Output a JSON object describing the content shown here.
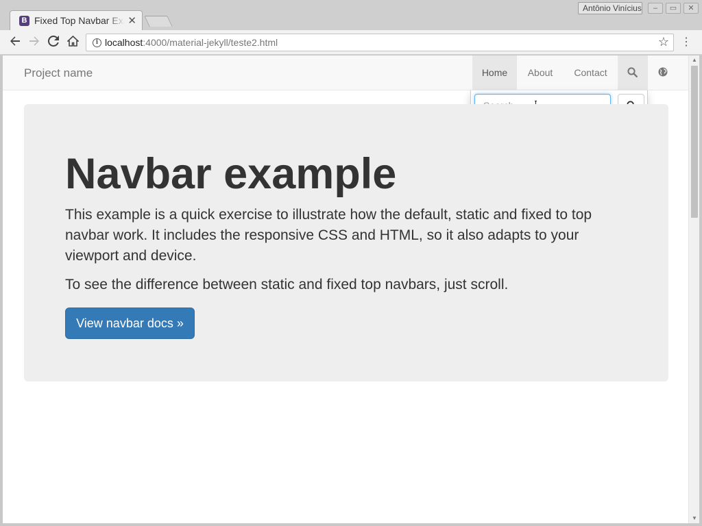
{
  "browser": {
    "tab": {
      "favicon_letter": "B",
      "title": "Fixed Top Navbar Example"
    },
    "user_name": "Antônio Vinícius",
    "omnibox": {
      "host": "localhost",
      "path": ":4000/material-jekyll/teste2.html"
    }
  },
  "navbar": {
    "brand": "Project name",
    "links": [
      {
        "label": "Home",
        "active": true
      },
      {
        "label": "About",
        "active": false
      },
      {
        "label": "Contact",
        "active": false
      }
    ],
    "icons": [
      "search-icon",
      "globe-icon"
    ]
  },
  "search": {
    "placeholder": "Search",
    "value": ""
  },
  "jumbotron": {
    "title": "Navbar example",
    "lead": "This example is a quick exercise to illustrate how the default, static and fixed to top navbar work. It includes the responsive CSS and HTML, so it also adapts to your viewport and device.",
    "note": "To see the difference between static and fixed top navbars, just scroll.",
    "button_label": "View navbar docs »"
  },
  "colors": {
    "primary": "#337ab7",
    "navbar_bg": "#f8f8f8",
    "jumbotron_bg": "#eeeeee",
    "focus": "#66afe9",
    "bootstrap_purple": "#563d7c"
  }
}
